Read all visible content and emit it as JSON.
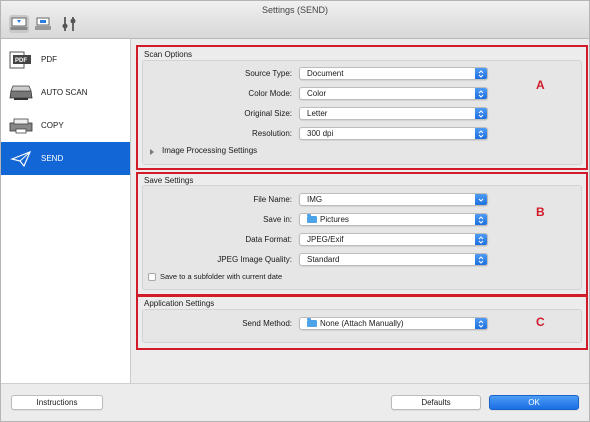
{
  "window": {
    "title": "Settings (SEND)"
  },
  "toolbar": {
    "icons": [
      "scan-from-computer-icon",
      "scan-from-operation-panel-icon",
      "general-settings-icon"
    ]
  },
  "sidebar": {
    "items": [
      {
        "label": "PDF",
        "icon": "pdf-icon"
      },
      {
        "label": "AUTO SCAN",
        "icon": "scanner-icon"
      },
      {
        "label": "COPY",
        "icon": "copy-icon"
      },
      {
        "label": "SEND",
        "icon": "send-icon",
        "selected": true
      }
    ]
  },
  "scan_options": {
    "title": "Scan Options",
    "marker": "A",
    "rows": [
      {
        "label": "Source Type:",
        "value": "Document"
      },
      {
        "label": "Color Mode:",
        "value": "Color"
      },
      {
        "label": "Original Size:",
        "value": "Letter"
      },
      {
        "label": "Resolution:",
        "value": "300 dpi"
      }
    ],
    "image_processing": "Image Processing Settings"
  },
  "save_settings": {
    "title": "Save Settings",
    "marker": "B",
    "file_name_label": "File Name:",
    "file_name_value": "IMG",
    "save_in_label": "Save in:",
    "save_in_value": "Pictures",
    "data_format_label": "Data Format:",
    "data_format_value": "JPEG/Exif",
    "jpeg_quality_label": "JPEG Image Quality:",
    "jpeg_quality_value": "Standard",
    "subfolder_label": "Save to a subfolder with current date",
    "subfolder_checked": false
  },
  "application_settings": {
    "title": "Application Settings",
    "marker": "C",
    "send_method_label": "Send Method:",
    "send_method_value": "None (Attach Manually)"
  },
  "footer": {
    "instructions": "Instructions",
    "defaults": "Defaults",
    "ok": "OK"
  },
  "colors": {
    "accent": "#1366d6",
    "marker": "#d11a2a"
  }
}
